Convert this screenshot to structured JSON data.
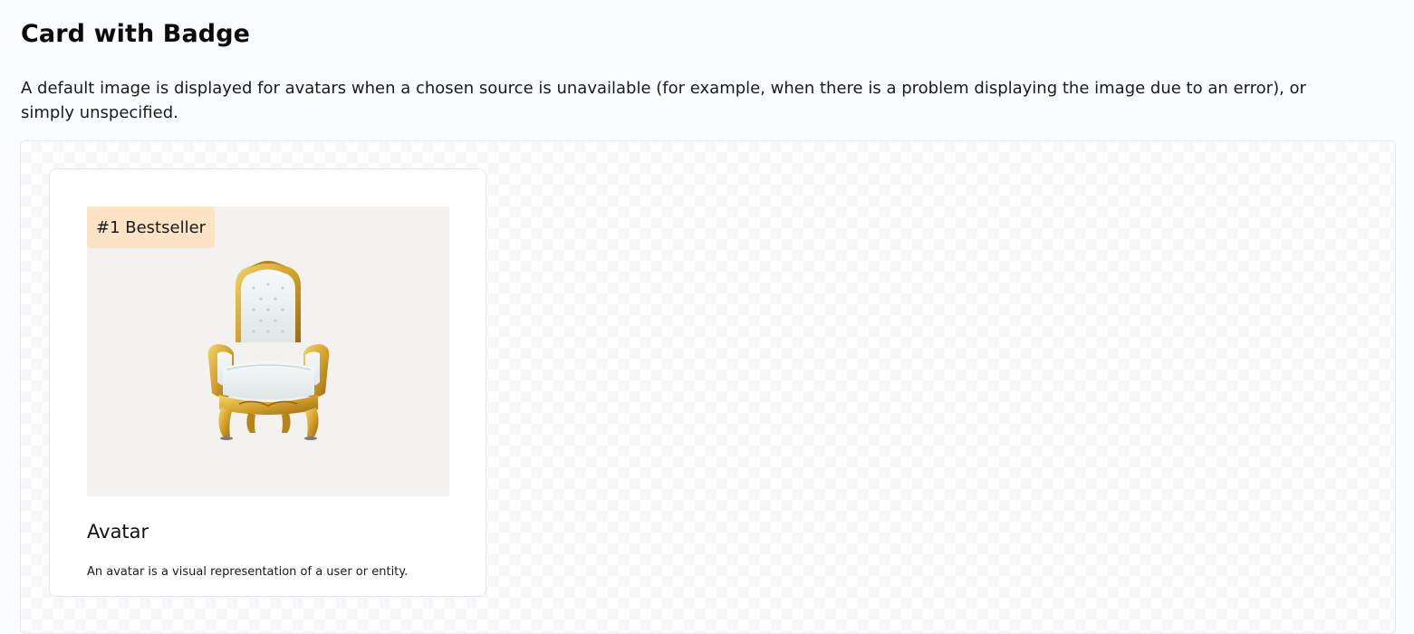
{
  "page": {
    "title": "Card with Badge",
    "description": "A default image is displayed for avatars when a chosen source is unavailable (for example, when there is a problem displaying the image due to an error), or simply unspecified."
  },
  "card": {
    "badge": "#1 Bestseller",
    "image_icon": "throne-chair-image",
    "title": "Avatar",
    "text": "An avatar is a visual representation of a user or entity."
  },
  "colors": {
    "badge_background": "#fde3c6",
    "media_background": "#f4f2f0",
    "chair_gold": "#d4a22a",
    "chair_upholstery": "#eef3f3"
  }
}
